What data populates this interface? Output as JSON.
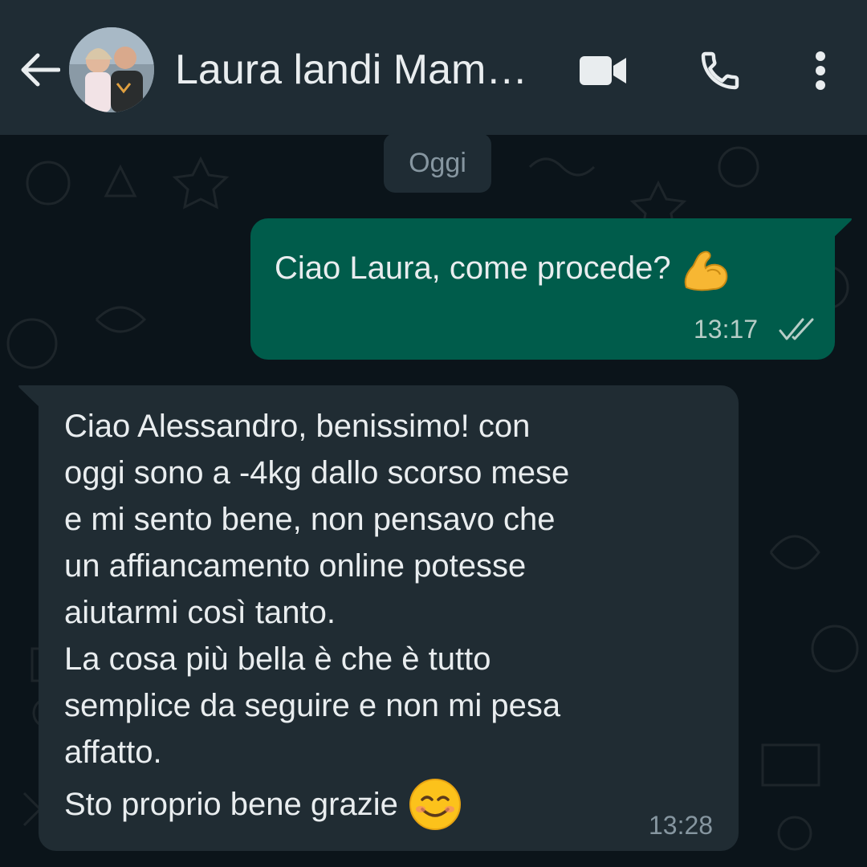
{
  "header": {
    "contact_name": "Laura landi Mam…",
    "back_icon": "arrow-back-icon",
    "video_icon": "video-call-icon",
    "call_icon": "phone-icon",
    "menu_icon": "more-vert-icon"
  },
  "chat": {
    "date_chip": "Oggi",
    "messages": [
      {
        "direction": "outgoing",
        "text": "Ciao Laura, come procede?",
        "emoji": "flexed-biceps-emoji",
        "time": "13:17",
        "status_icon": "double-check-icon"
      },
      {
        "direction": "incoming",
        "lines": [
          "Ciao Alessandro,  benissimo! con",
          "oggi sono a -4kg dallo scorso mese",
          "e mi sento bene, non pensavo che",
          "un affiancamento online potesse",
          "aiutarmi così tanto.",
          "La cosa più bella è che è tutto",
          "semplice da seguire e non mi pesa",
          "affatto."
        ],
        "last_line": "Sto proprio bene grazie",
        "emoji": "smiling-face-emoji",
        "time": "13:28"
      }
    ]
  },
  "colors": {
    "background": "#0b141a",
    "header": "#1f2c34",
    "outgoing_bubble": "#005c4b",
    "incoming_bubble": "#202c33",
    "text": "#e9edef",
    "meta": "#8696a0"
  }
}
